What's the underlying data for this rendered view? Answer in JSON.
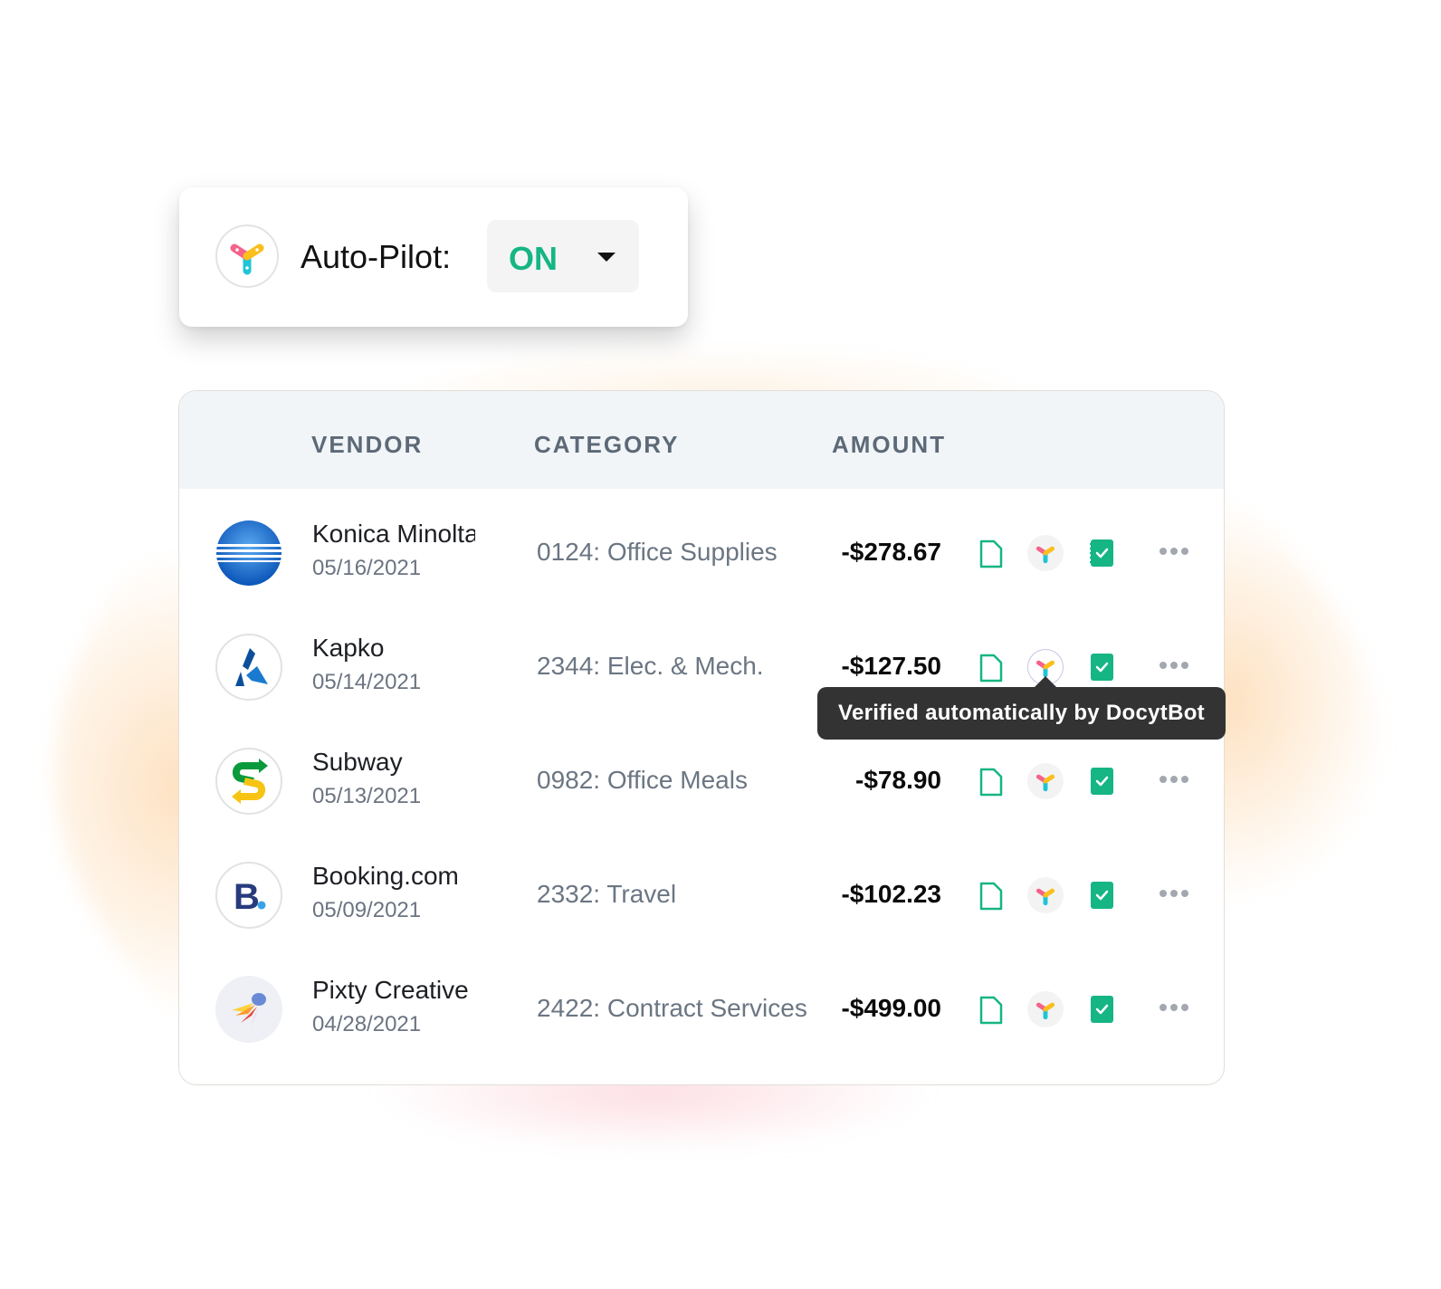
{
  "autopilot": {
    "label": "Auto-Pilot:",
    "value": "ON",
    "value_color": "#16b584",
    "logo_icon": "docytbot-logo-icon"
  },
  "table": {
    "columns": [
      "VENDOR",
      "CATEGORY",
      "AMOUNT"
    ],
    "rows": [
      {
        "vendor": "Konica Minolta",
        "date": "05/16/2021",
        "category": "0124: Office Supplies",
        "amount": "-$278.67",
        "logo": "konica-minolta-logo"
      },
      {
        "vendor": "Kapko",
        "date": "05/14/2021",
        "category": "2344: Elec. & Mech.",
        "amount": "-$127.50",
        "logo": "kapko-logo"
      },
      {
        "vendor": "Subway",
        "date": "05/13/2021",
        "category": "0982: Office Meals",
        "amount": "-$78.90",
        "logo": "subway-logo"
      },
      {
        "vendor": "Booking.com",
        "date": "05/09/2021",
        "category": "2332: Travel",
        "amount": "-$102.23",
        "logo": "booking-logo"
      },
      {
        "vendor": "Pixty Creative",
        "date": "04/28/2021",
        "category": "2422: Contract Services",
        "amount": "-$499.00",
        "logo": "pixty-logo"
      }
    ],
    "row_icons": [
      "document-icon",
      "docytbot-icon",
      "verified-notebook-icon",
      "more-options-icon"
    ]
  },
  "tooltip": {
    "text": "Verified automatically by DocytBot"
  },
  "colors": {
    "accent_green": "#16b584",
    "header_bg": "#f1f5f8",
    "tooltip_bg": "#333333"
  }
}
